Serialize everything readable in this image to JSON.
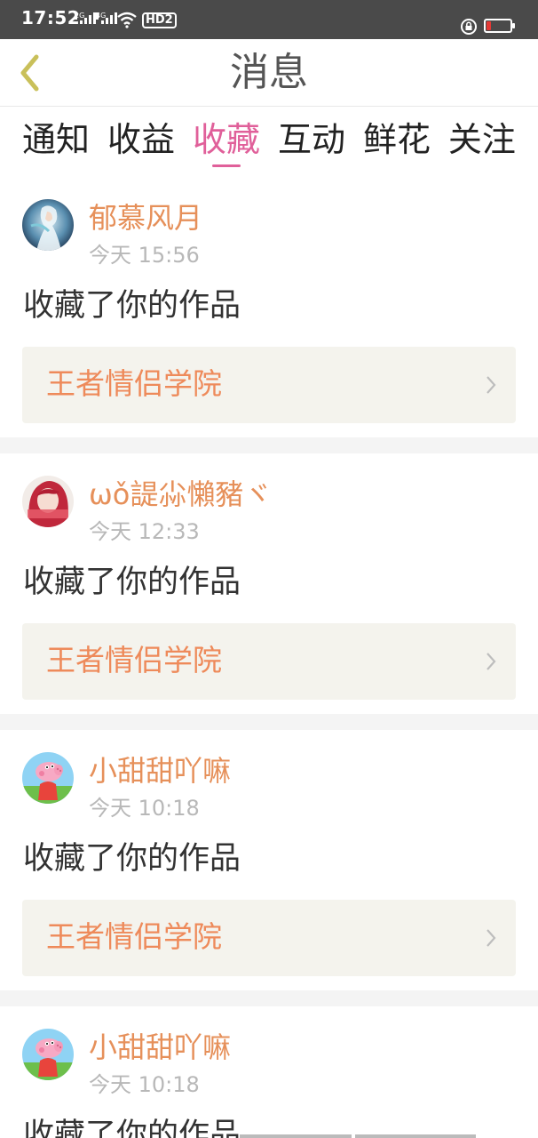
{
  "status_bar": {
    "time": "17:52",
    "signal1_label": "2G",
    "signal2_label": "4G",
    "hd_label": "HD2",
    "battery_level": 0.1,
    "battery_color": "#e53935"
  },
  "header": {
    "title": "消息",
    "back_icon": "chevron-left-icon"
  },
  "tabs": [
    {
      "label": "通知",
      "active": false
    },
    {
      "label": "收益",
      "active": false
    },
    {
      "label": "收藏",
      "active": true
    },
    {
      "label": "互动",
      "active": false
    },
    {
      "label": "鲜花",
      "active": false
    },
    {
      "label": "关注",
      "active": false
    }
  ],
  "colors": {
    "accent_pink": "#e0609a",
    "username_orange": "#e6905a",
    "work_title_orange": "#ee8a5a",
    "work_box_bg": "#f4f3ed"
  },
  "messages": [
    {
      "username": "郁慕风月",
      "time": "今天 15:56",
      "action": "收藏了你的作品",
      "work_title": "王者情侣学院",
      "avatar": "anime-character-avatar"
    },
    {
      "username": "ωǒ諟尛懶豬ヾ",
      "time": "今天 12:33",
      "action": "收藏了你的作品",
      "work_title": "王者情侣学院",
      "avatar": "girl-photo-avatar"
    },
    {
      "username": "小甜甜吖嘛",
      "time": "今天 10:18",
      "action": "收藏了你的作品",
      "work_title": "王者情侣学院",
      "avatar": "peppa-pig-avatar"
    },
    {
      "username": "小甜甜吖嘛",
      "time": "今天 10:18",
      "action": "收藏了你的作品",
      "work_title": "",
      "avatar": "peppa-pig-avatar"
    }
  ]
}
